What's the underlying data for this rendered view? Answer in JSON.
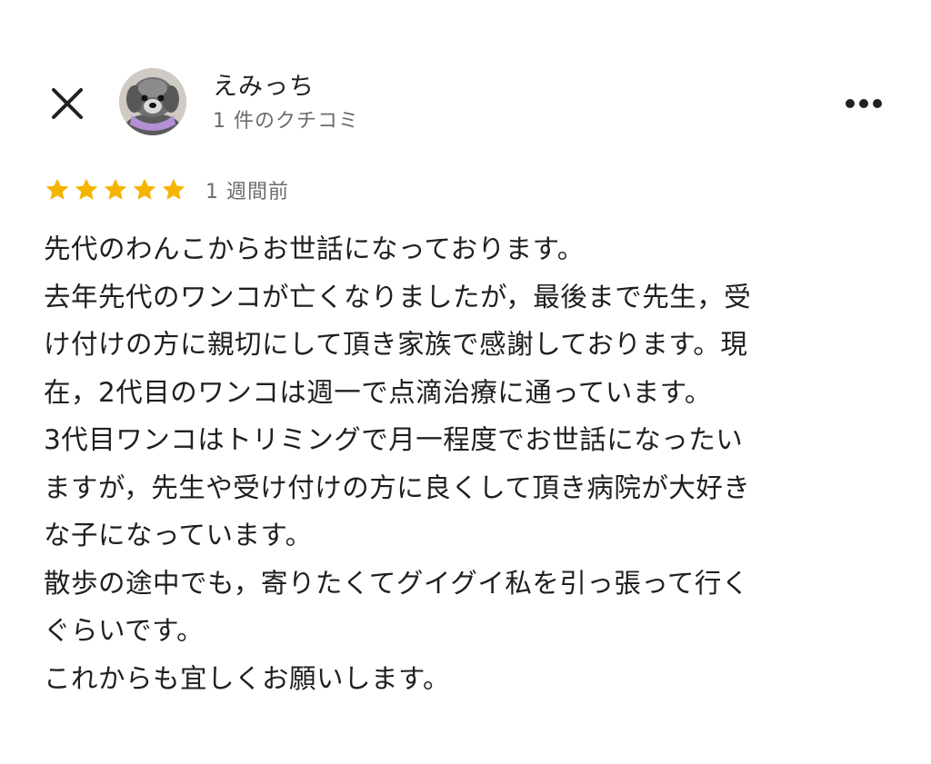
{
  "header": {
    "close_icon": "close-icon",
    "more_icon": "more-horizontal-icon"
  },
  "reviewer": {
    "name": "えみっち",
    "review_count": "1 件のクチコミ",
    "avatar": "dog-photo-avatar"
  },
  "review": {
    "rating": 5,
    "max_rating": 5,
    "star_color": "#f4b400",
    "time": "1 週間前",
    "lines": [
      "先代のわんこからお世話になっております。",
      "去年先代のワンコが亡くなりましたが，最後まで先生，受",
      "け付けの方に親切にして頂き家族で感謝しております。現",
      "在，2代目のワンコは週一で点滴治療に通っています。",
      "3代目ワンコはトリミングで月一程度でお世話になったい",
      "ますが，先生や受け付けの方に良くして頂き病院が大好き",
      "な子になっています。",
      "散歩の途中でも，寄りたくてグイグイ私を引っ張って行く",
      "ぐらいです。",
      "これからも宜しくお願いします。"
    ]
  }
}
